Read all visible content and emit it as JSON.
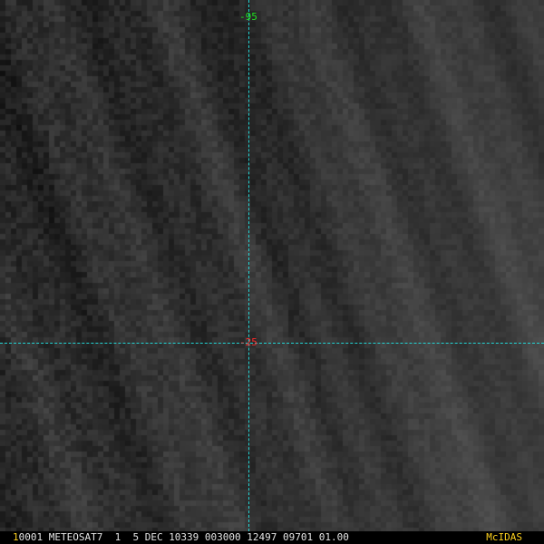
{
  "overlay": {
    "lon_label": "-95",
    "lat_label": "-25"
  },
  "statusbar": {
    "frame": "1",
    "text": "0001 METEOSAT7  1  5 DEC 10339 003000 12497 09701 01.00",
    "brand": "McIDAS"
  },
  "colors": {
    "grid_line": "#22d6d6",
    "lon_label": "#22e022",
    "lat_label": "#ff2a2a",
    "brand": "#ffd21e"
  }
}
